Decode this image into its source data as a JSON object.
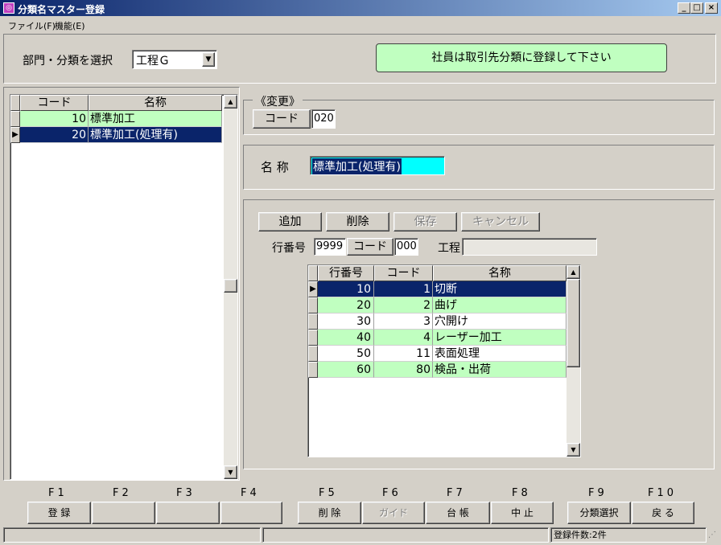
{
  "window": {
    "title": "分類名マスター登録"
  },
  "menu": {
    "file": "ファイル(F)",
    "function": "機能(E)"
  },
  "top": {
    "dept_label": "部門・分類を選択",
    "dept_value": "工程Ｇ",
    "notice": "社員は取引先分類に登録して下さい"
  },
  "left_list": {
    "headers": [
      "コード",
      "名称"
    ],
    "rows": [
      {
        "code": "10",
        "name": "標準加工"
      },
      {
        "code": "20",
        "name": "標準加工(処理有)"
      }
    ]
  },
  "change": {
    "group_label": "《変更》",
    "code_label": "コード",
    "code_value": "020",
    "name_label": "名 称",
    "name_value": "標準加工(処理有)"
  },
  "detail": {
    "buttons": {
      "add": "追加",
      "delete": "削除",
      "save": "保存",
      "cancel": "キャンセル"
    },
    "row_no_label": "行番号",
    "row_no_value": "9999",
    "code_label": "コード",
    "code_value": "000",
    "process_label": "工程",
    "process_value": "",
    "headers": [
      "行番号",
      "コード",
      "名称"
    ],
    "rows": [
      {
        "no": "10",
        "code": "1",
        "name": "切断"
      },
      {
        "no": "20",
        "code": "2",
        "name": "曲げ"
      },
      {
        "no": "30",
        "code": "3",
        "name": "穴開け"
      },
      {
        "no": "40",
        "code": "4",
        "name": "レーザー加工"
      },
      {
        "no": "50",
        "code": "11",
        "name": "表面処理"
      },
      {
        "no": "60",
        "code": "80",
        "name": "検品・出荷"
      }
    ]
  },
  "fkeys": {
    "keys": [
      "F1",
      "F2",
      "F3",
      "F4",
      "F5",
      "F6",
      "F7",
      "F8",
      "F9",
      "F10"
    ],
    "labels": [
      "登 録",
      "",
      "",
      "",
      "削 除",
      "ガイド",
      "台 帳",
      "中 止",
      "分類選択",
      "戻 る"
    ]
  },
  "status": {
    "count": "登録件数:2件"
  },
  "colors": {
    "selected": "#0a246a",
    "alt_row": "#c0ffc0",
    "notice_bg": "#c0ffc0",
    "name_input_bg": "#00ffff"
  }
}
